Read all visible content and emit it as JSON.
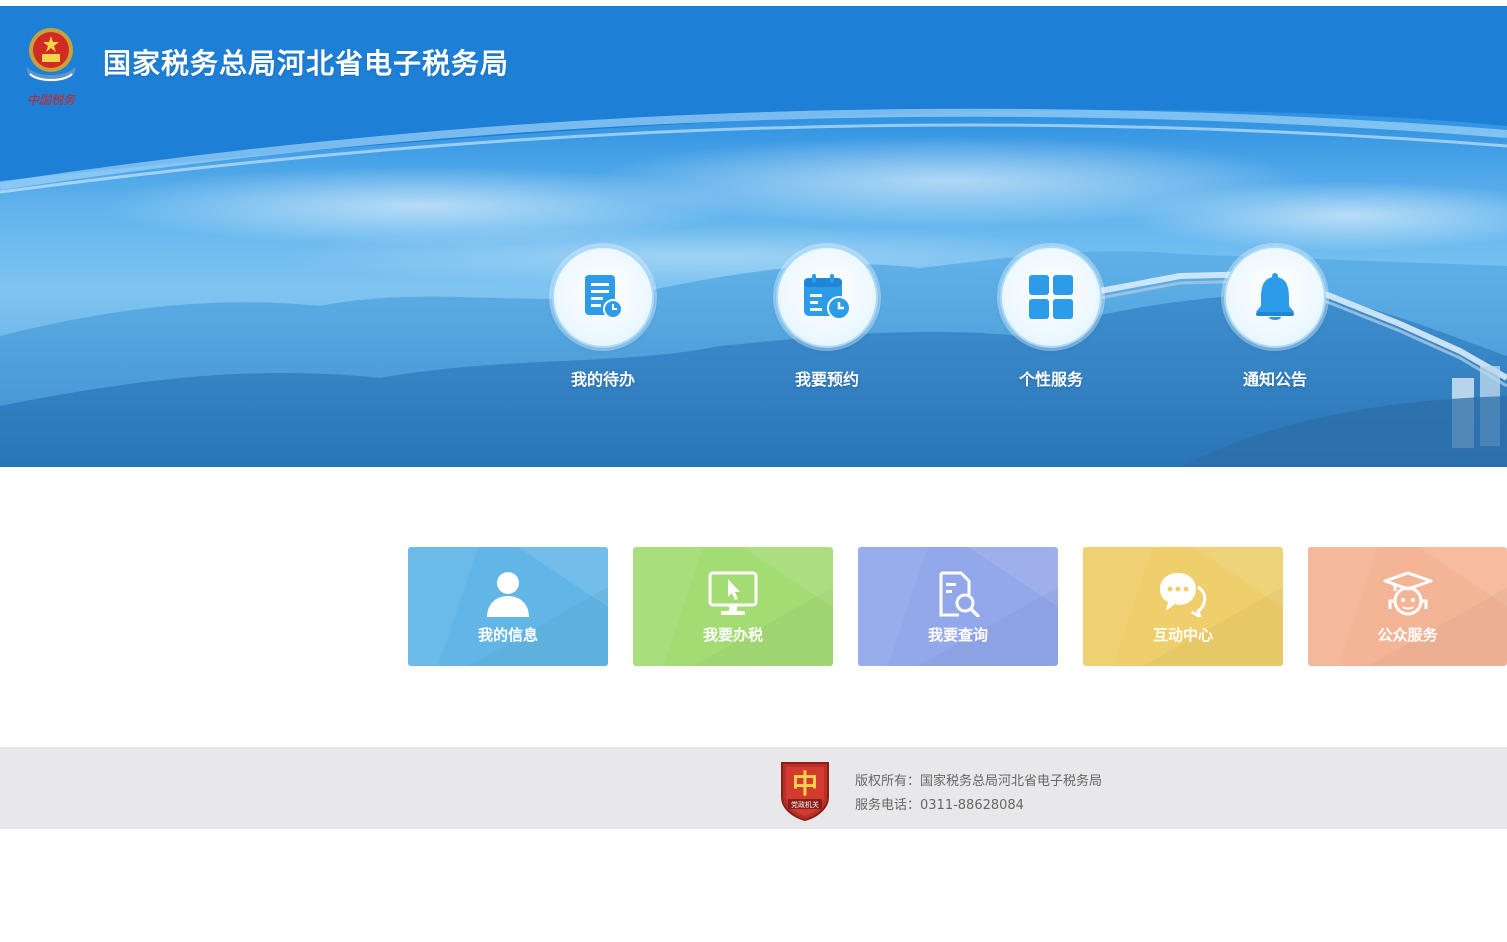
{
  "header": {
    "title": "国家税务总局河北省电子税务局",
    "logo_caption": "中国税务"
  },
  "quick_nav": [
    {
      "label": "我的待办",
      "icon": "todo-doc-icon"
    },
    {
      "label": "我要预约",
      "icon": "calendar-clock-icon"
    },
    {
      "label": "个性服务",
      "icon": "grid-icon"
    },
    {
      "label": "通知公告",
      "icon": "bell-icon"
    }
  ],
  "tiles": [
    {
      "label": "我的信息",
      "icon": "user-icon",
      "color": "#62b6e7"
    },
    {
      "label": "我要办税",
      "icon": "monitor-cursor-icon",
      "color": "#a4dc74"
    },
    {
      "label": "我要查询",
      "icon": "doc-search-icon",
      "color": "#92a8ea"
    },
    {
      "label": "互动中心",
      "icon": "chat-bubbles-icon",
      "color": "#eecf6b"
    },
    {
      "label": "公众服务",
      "icon": "graduate-icon",
      "color": "#f4b596"
    }
  ],
  "footer": {
    "badge_text": "党政机关",
    "copyright": "版权所有：国家税务总局河北省电子税务局",
    "phone": "服务电话：0311-88628084"
  }
}
